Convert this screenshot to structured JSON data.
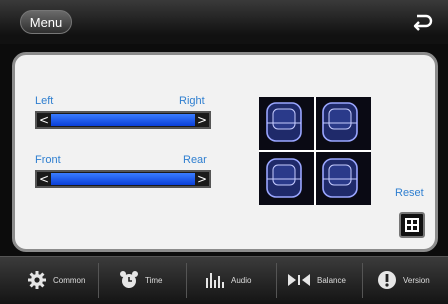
{
  "header": {
    "menu_label": "Menu",
    "back_icon": "return-arrow-icon"
  },
  "left_right": {
    "left_label": "Left",
    "right_label": "Right",
    "left_arrow": "<",
    "right_arrow": ">"
  },
  "front_rear": {
    "front_label": "Front",
    "rear_label": "Rear",
    "left_arrow": "<",
    "right_arrow": ">"
  },
  "reset": {
    "label": "Reset"
  },
  "tabs": [
    {
      "label": "Common",
      "icon": "gear-icon"
    },
    {
      "label": "Time",
      "icon": "alarm-clock-icon"
    },
    {
      "label": "Audio",
      "icon": "equalizer-icon"
    },
    {
      "label": "Balance",
      "icon": "balance-icon"
    },
    {
      "label": "Version",
      "icon": "info-icon"
    }
  ],
  "colors": {
    "accent": "#2f7fd0",
    "slider_fill": "#1f5cff",
    "panel_bg": "#f2f2f2",
    "bar_bg": "#1c1c1c"
  }
}
